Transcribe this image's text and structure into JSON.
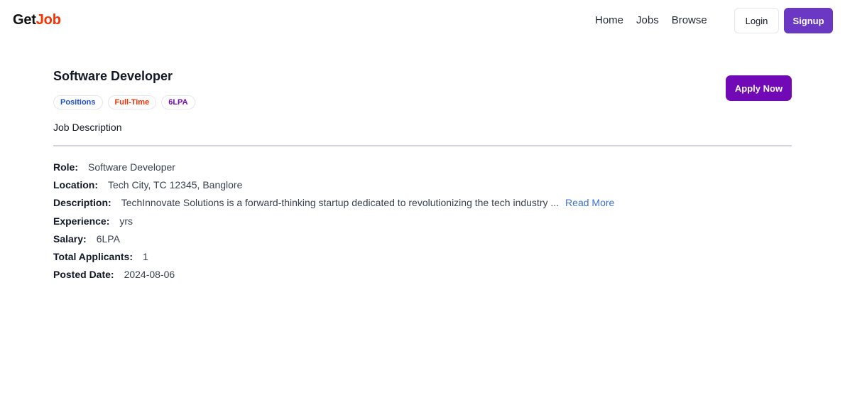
{
  "navbar": {
    "logo_part1": "Get",
    "logo_part2": "Job",
    "links": [
      "Home",
      "Jobs",
      "Browse"
    ],
    "login_label": "Login",
    "signup_label": "Signup"
  },
  "job": {
    "title": "Software Developer",
    "badges": [
      "Positions",
      "Full-Time",
      "6LPA"
    ],
    "apply_label": "Apply Now",
    "section_heading": "Job Description",
    "details": {
      "role_label": "Role:",
      "role": "Software Developer",
      "location_label": "Location:",
      "location": "Tech City, TC 12345, Banglore",
      "description_label": "Description:",
      "description": "TechInnovate Solutions is a forward-thinking startup dedicated to revolutionizing the tech industry ...",
      "read_more": "Read More",
      "experience_label": "Experience:",
      "experience": "yrs",
      "salary_label": "Salary:",
      "salary": "6LPA",
      "applicants_label": "Total Applicants:",
      "applicants": "1",
      "posted_label": "Posted Date:",
      "posted": "2024-08-06"
    }
  },
  "colors": {
    "brand_accent": "#f83002",
    "signup_bg": "#6a38c2",
    "apply_bg": "#7209b7",
    "badge_blue": "#1d4ed8",
    "badge_red": "#f83002",
    "badge_purple": "#7209b7",
    "link_blue": "#3b6fd6"
  }
}
